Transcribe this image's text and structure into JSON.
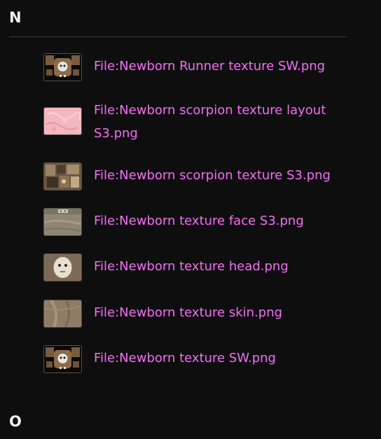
{
  "sections": [
    {
      "letter": "N",
      "items": [
        {
          "label": "File:Newborn Runner texture SW.png",
          "thumb": "runner-texture-thumbnail"
        },
        {
          "label": "File:Newborn scorpion texture layout S3.png",
          "thumb": "pink-layout-thumbnail"
        },
        {
          "label": "File:Newborn scorpion texture S3.png",
          "thumb": "scorpion-texture-thumbnail"
        },
        {
          "label": "File:Newborn texture face S3.png",
          "thumb": "face-texture-thumbnail"
        },
        {
          "label": "File:Newborn texture head.png",
          "thumb": "head-texture-thumbnail"
        },
        {
          "label": "File:Newborn texture skin.png",
          "thumb": "skin-texture-thumbnail"
        },
        {
          "label": "File:Newborn texture SW.png",
          "thumb": "sw-texture-thumbnail"
        }
      ]
    },
    {
      "letter": "O",
      "items": []
    }
  ],
  "colors": {
    "background": "#0e0e0f",
    "link": "#f36ff2",
    "heading": "#f2f2f2",
    "divider": "#3a3a3c"
  }
}
